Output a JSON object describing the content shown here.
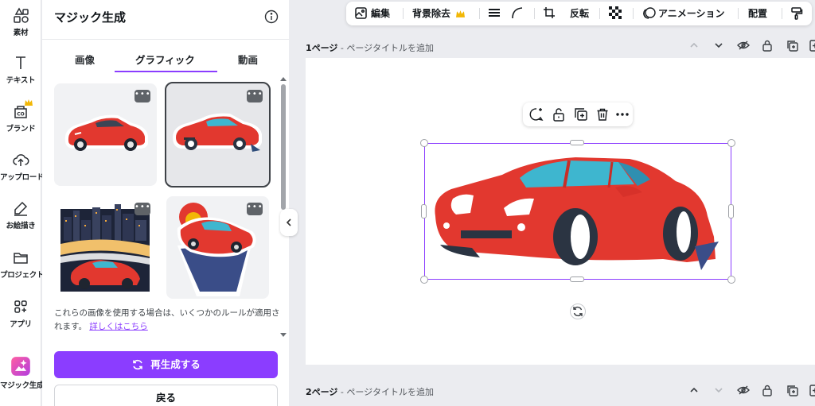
{
  "rail": {
    "items": [
      {
        "label": "素材",
        "icon": "elements-icon"
      },
      {
        "label": "テキスト",
        "icon": "text-icon"
      },
      {
        "label": "ブランド",
        "icon": "brand-icon"
      },
      {
        "label": "アップロード",
        "icon": "upload-icon"
      },
      {
        "label": "お絵描き",
        "icon": "draw-icon"
      },
      {
        "label": "プロジェクト",
        "icon": "folder-icon"
      },
      {
        "label": "アプリ",
        "icon": "apps-icon"
      },
      {
        "label": "マジック生成",
        "icon": "magic-media-icon"
      }
    ]
  },
  "panel": {
    "title": "マジック生成",
    "tabs": [
      "画像",
      "グラフィック",
      "動画"
    ],
    "active_tab": "グラフィック",
    "thumb_menu": "•••",
    "notice_text": "これらの画像を使用する場合は、いくつかのルールが適用されます。",
    "notice_link": "詳しくはこちら",
    "regenerate_label": "再生成する",
    "back_label": "戻る"
  },
  "toolbar": {
    "edit": "編集",
    "bg_remove": "背景除去",
    "flip": "反転",
    "animate": "アニメーション",
    "position": "配置"
  },
  "pages": [
    {
      "number_label": "1ページ",
      "title_placeholder": "ページタイトルを追加"
    },
    {
      "number_label": "2ページ",
      "title_placeholder": "ページタイトルを追加"
    }
  ],
  "colors": {
    "accent": "#8b3dff",
    "car_red": "#e23b36",
    "car_window": "#3eb6cf"
  }
}
